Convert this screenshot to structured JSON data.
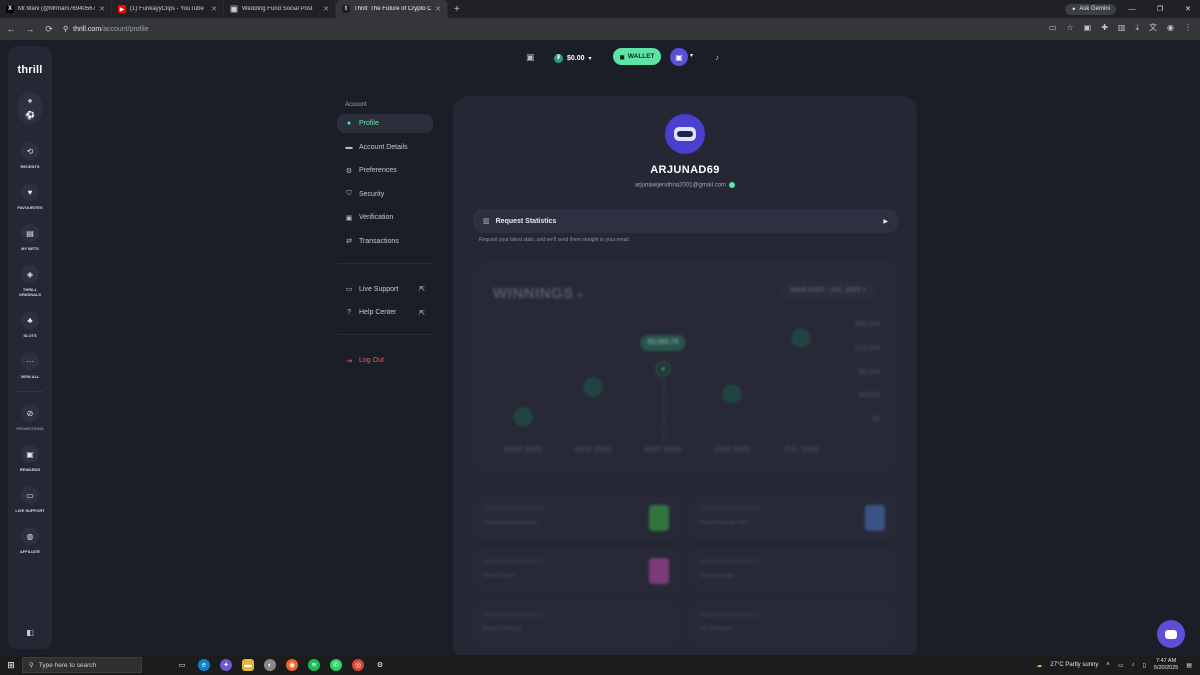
{
  "browser": {
    "tabs": [
      {
        "title": "Mr.Mani (@Mrmani76940567) / X",
        "favicon": "X",
        "color": "#000000"
      },
      {
        "title": "(1) FunkayyClips - YouTube",
        "favicon": "▶",
        "color": "#ff0000"
      },
      {
        "title": "Wedding Fund Social Post",
        "favicon": "▦",
        "color": "#5f6368"
      },
      {
        "title": "Thrill: The Future of Crypto Casino",
        "favicon": "t",
        "color": "#1b1d27"
      }
    ],
    "ask_gemini": "Ask Gemini",
    "url_host": "thrill.com",
    "url_path": "/account/profile"
  },
  "sidebar": {
    "logo": "thrill",
    "items": [
      {
        "label": "RECENTS",
        "icon": "⟲"
      },
      {
        "label": "FAVOURITES",
        "icon": "♥"
      },
      {
        "label": "MY BETS",
        "icon": "▤"
      },
      {
        "label": "THRILL ORIGINALS",
        "icon": "◈"
      },
      {
        "label": "SLOTS",
        "icon": "♣"
      },
      {
        "label": "VIEW ALL",
        "icon": "···"
      },
      {
        "label": "PROMOTIONS",
        "icon": "⊘"
      },
      {
        "label": "REWARDS",
        "icon": "▣"
      },
      {
        "label": "LIVE SUPPORT",
        "icon": "▭"
      },
      {
        "label": "AFFILIATE",
        "icon": "◍"
      }
    ]
  },
  "topbar": {
    "balance": "$0.00",
    "wallet_label": "WALLET"
  },
  "account_menu": {
    "heading": "Account",
    "items": [
      {
        "label": "Profile",
        "icon": "●"
      },
      {
        "label": "Account Details",
        "icon": "▬"
      },
      {
        "label": "Preferences",
        "icon": "⚙"
      },
      {
        "label": "Security",
        "icon": "⛉"
      },
      {
        "label": "Verification",
        "icon": "▣"
      },
      {
        "label": "Transactions",
        "icon": "⇄"
      }
    ],
    "support": [
      {
        "label": "Live Support",
        "icon": "▭"
      },
      {
        "label": "Help Center",
        "icon": "?"
      }
    ],
    "logout": "Log Out"
  },
  "profile": {
    "username": "ARJUNAD69",
    "email": "arjunawijerathna2001@gmail.com",
    "request_stats_label": "Request Statistics",
    "request_stats_hint": "Request your latest stats, and we'll send them straight to your email."
  },
  "winnings": {
    "title": "WINNINGS",
    "range": "MAR 2025 - JUL 2025",
    "tooltip": "$5,500.75",
    "y_ticks": [
      "$20,000",
      "$12,000",
      "$8,000",
      "$4,000",
      "$0"
    ]
  },
  "chart_data": {
    "type": "scatter",
    "title": "WINNINGS",
    "categories": [
      "MAR 2025",
      "APR 2025",
      "MAY 2025",
      "JUN 2025",
      "JUL 2025"
    ],
    "y_ticks": [
      "$0",
      "$4,000",
      "$8,000",
      "$12,000",
      "$20,000"
    ],
    "values": [
      1500,
      5800,
      8500,
      4800,
      13000
    ],
    "highlighted": {
      "category": "MAY 2025",
      "label": "$5,500.75"
    }
  },
  "stats": [
    {
      "caption": "Greatest Achievement",
      "color": "#3bb34a"
    },
    {
      "caption": "Most Fortunate Win",
      "color": "#4a78c9"
    },
    {
      "caption": "Most Played",
      "color": "#c34ab0"
    },
    {
      "caption": "Total Earnings",
      "color": ""
    },
    {
      "caption": "Bonus Earnings",
      "color": ""
    },
    {
      "caption": "VIP Rewards",
      "color": ""
    }
  ],
  "taskbar": {
    "search_placeholder": "Type here to search",
    "weather": "27°C  Partly sunny",
    "time": "7:47 AM",
    "date": "5/20/2025"
  }
}
